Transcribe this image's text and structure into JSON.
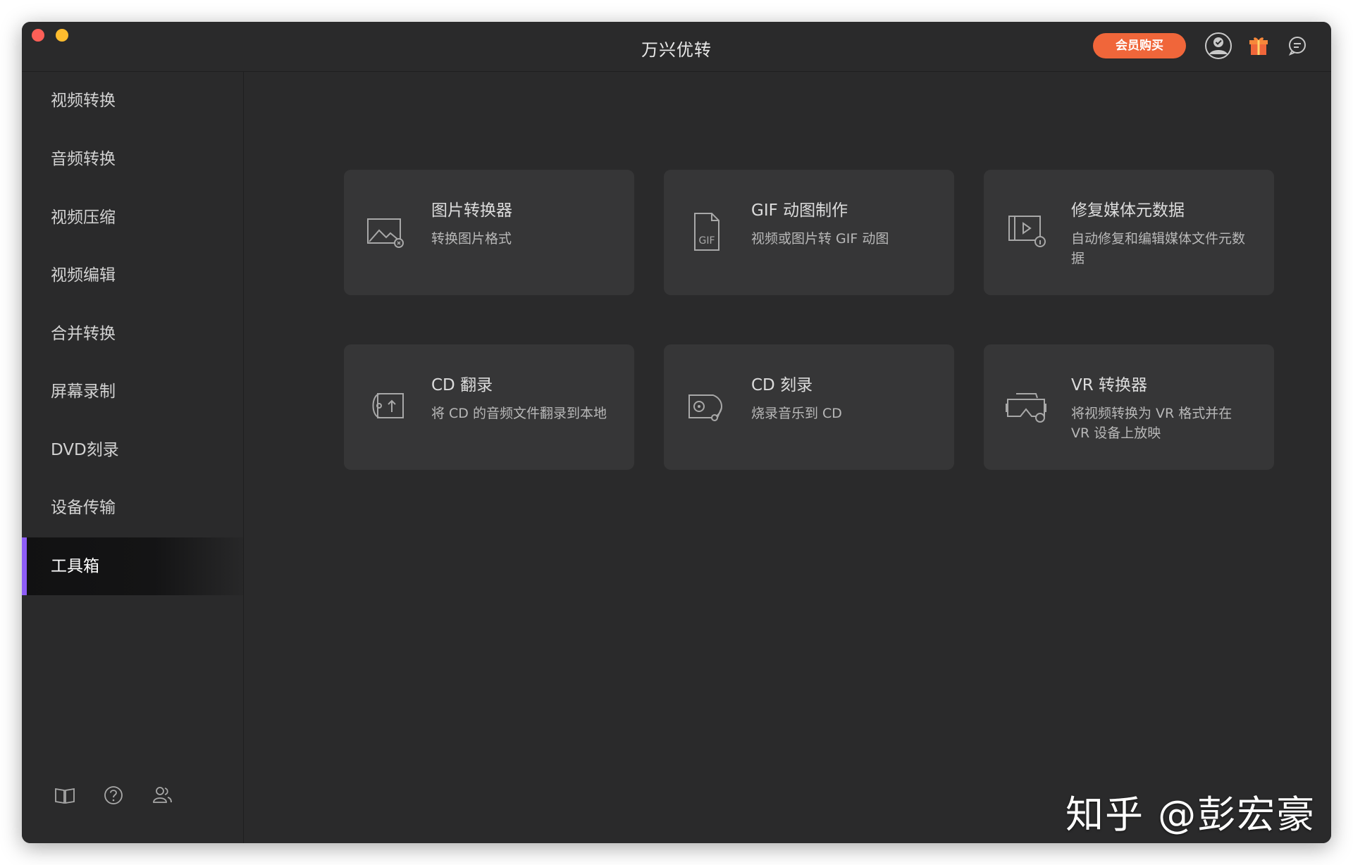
{
  "app": {
    "title": "万兴优转"
  },
  "header": {
    "vip_label": "会员购买"
  },
  "sidebar": {
    "items": [
      {
        "label": "视频转换"
      },
      {
        "label": "音频转换"
      },
      {
        "label": "视频压缩"
      },
      {
        "label": "视频编辑"
      },
      {
        "label": "合并转换"
      },
      {
        "label": "屏幕录制"
      },
      {
        "label": "DVD刻录"
      },
      {
        "label": "设备传输"
      },
      {
        "label": "工具箱",
        "active": true
      }
    ]
  },
  "toolbox": {
    "cards": [
      {
        "title": "图片转换器",
        "desc": "转换图片格式",
        "icon": "image-convert-icon"
      },
      {
        "title": "GIF 动图制作",
        "desc": "视频或图片转 GIF 动图",
        "icon": "gif-file-icon"
      },
      {
        "title": "修复媒体元数据",
        "desc": "自动修复和编辑媒体文件元数据",
        "icon": "media-metadata-icon"
      },
      {
        "title": "CD 翻录",
        "desc": "将 CD 的音频文件翻录到本地",
        "icon": "cd-rip-icon"
      },
      {
        "title": "CD 刻录",
        "desc": "烧录音乐到 CD",
        "icon": "cd-burn-icon"
      },
      {
        "title": "VR 转换器",
        "desc": "将视频转换为 VR 格式并在 VR 设备上放映",
        "icon": "vr-headset-icon"
      }
    ]
  },
  "watermark": {
    "text": "知乎 @彭宏豪"
  },
  "colors": {
    "accent": "#8d5cf6",
    "vip": "#f0663a",
    "background": "#2a2a2b",
    "card": "#363637"
  }
}
